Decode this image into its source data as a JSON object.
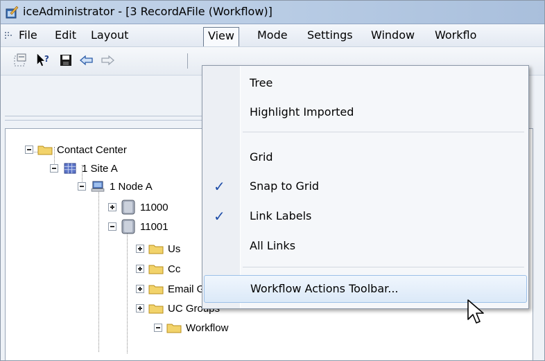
{
  "window": {
    "title": "iceAdministrator - [3 RecordAFile (Workflow)]"
  },
  "menubar": {
    "items": [
      {
        "label": "File"
      },
      {
        "label": "Edit"
      },
      {
        "label": "Layout"
      },
      {
        "label": "View",
        "active": true
      },
      {
        "label": "Mode"
      },
      {
        "label": "Settings"
      },
      {
        "label": "Window"
      },
      {
        "label": "Workflo"
      }
    ]
  },
  "toolbar": {
    "icons": [
      "new-window-icon",
      "help-pointer-icon",
      "save-icon",
      "back-arrow-icon",
      "forward-arrow-icon"
    ]
  },
  "view_menu": {
    "items": [
      {
        "label": "Tree",
        "checked": false
      },
      {
        "label": "Highlight Imported",
        "checked": false
      },
      {
        "label": "Grid",
        "checked": false
      },
      {
        "label": "Snap to Grid",
        "checked": true
      },
      {
        "label": "Link Labels",
        "checked": true
      },
      {
        "label": "All Links",
        "checked": false
      },
      {
        "label": "Workflow Actions Toolbar...",
        "checked": false,
        "highlighted": true
      }
    ],
    "check_glyph": "✓"
  },
  "tree": {
    "nodes": [
      {
        "label": "Contact Center",
        "icon": "folder-icon",
        "expander": "minus"
      },
      {
        "label": "1 Site A",
        "icon": "grid-site-icon",
        "expander": "minus"
      },
      {
        "label": "1 Node A",
        "icon": "computer-icon",
        "expander": "minus"
      },
      {
        "label": "11000",
        "icon": "server-icon",
        "expander": "plus"
      },
      {
        "label": "11001",
        "icon": "server-icon",
        "expander": "minus"
      },
      {
        "label": "Us",
        "icon": "folder-icon",
        "expander": "plus"
      },
      {
        "label": "Cc",
        "icon": "folder-icon",
        "expander": "plus"
      },
      {
        "label": "Email Groups",
        "icon": "folder-icon",
        "expander": "plus"
      },
      {
        "label": "UC Groups",
        "icon": "folder-icon",
        "expander": "plus"
      },
      {
        "label": "Workflow",
        "icon": "folder-icon",
        "expander": "minus"
      }
    ]
  },
  "colors": {
    "menu_highlight": "#dbe9f8",
    "check": "#1f4ea8",
    "folder": "#f2d36b"
  }
}
